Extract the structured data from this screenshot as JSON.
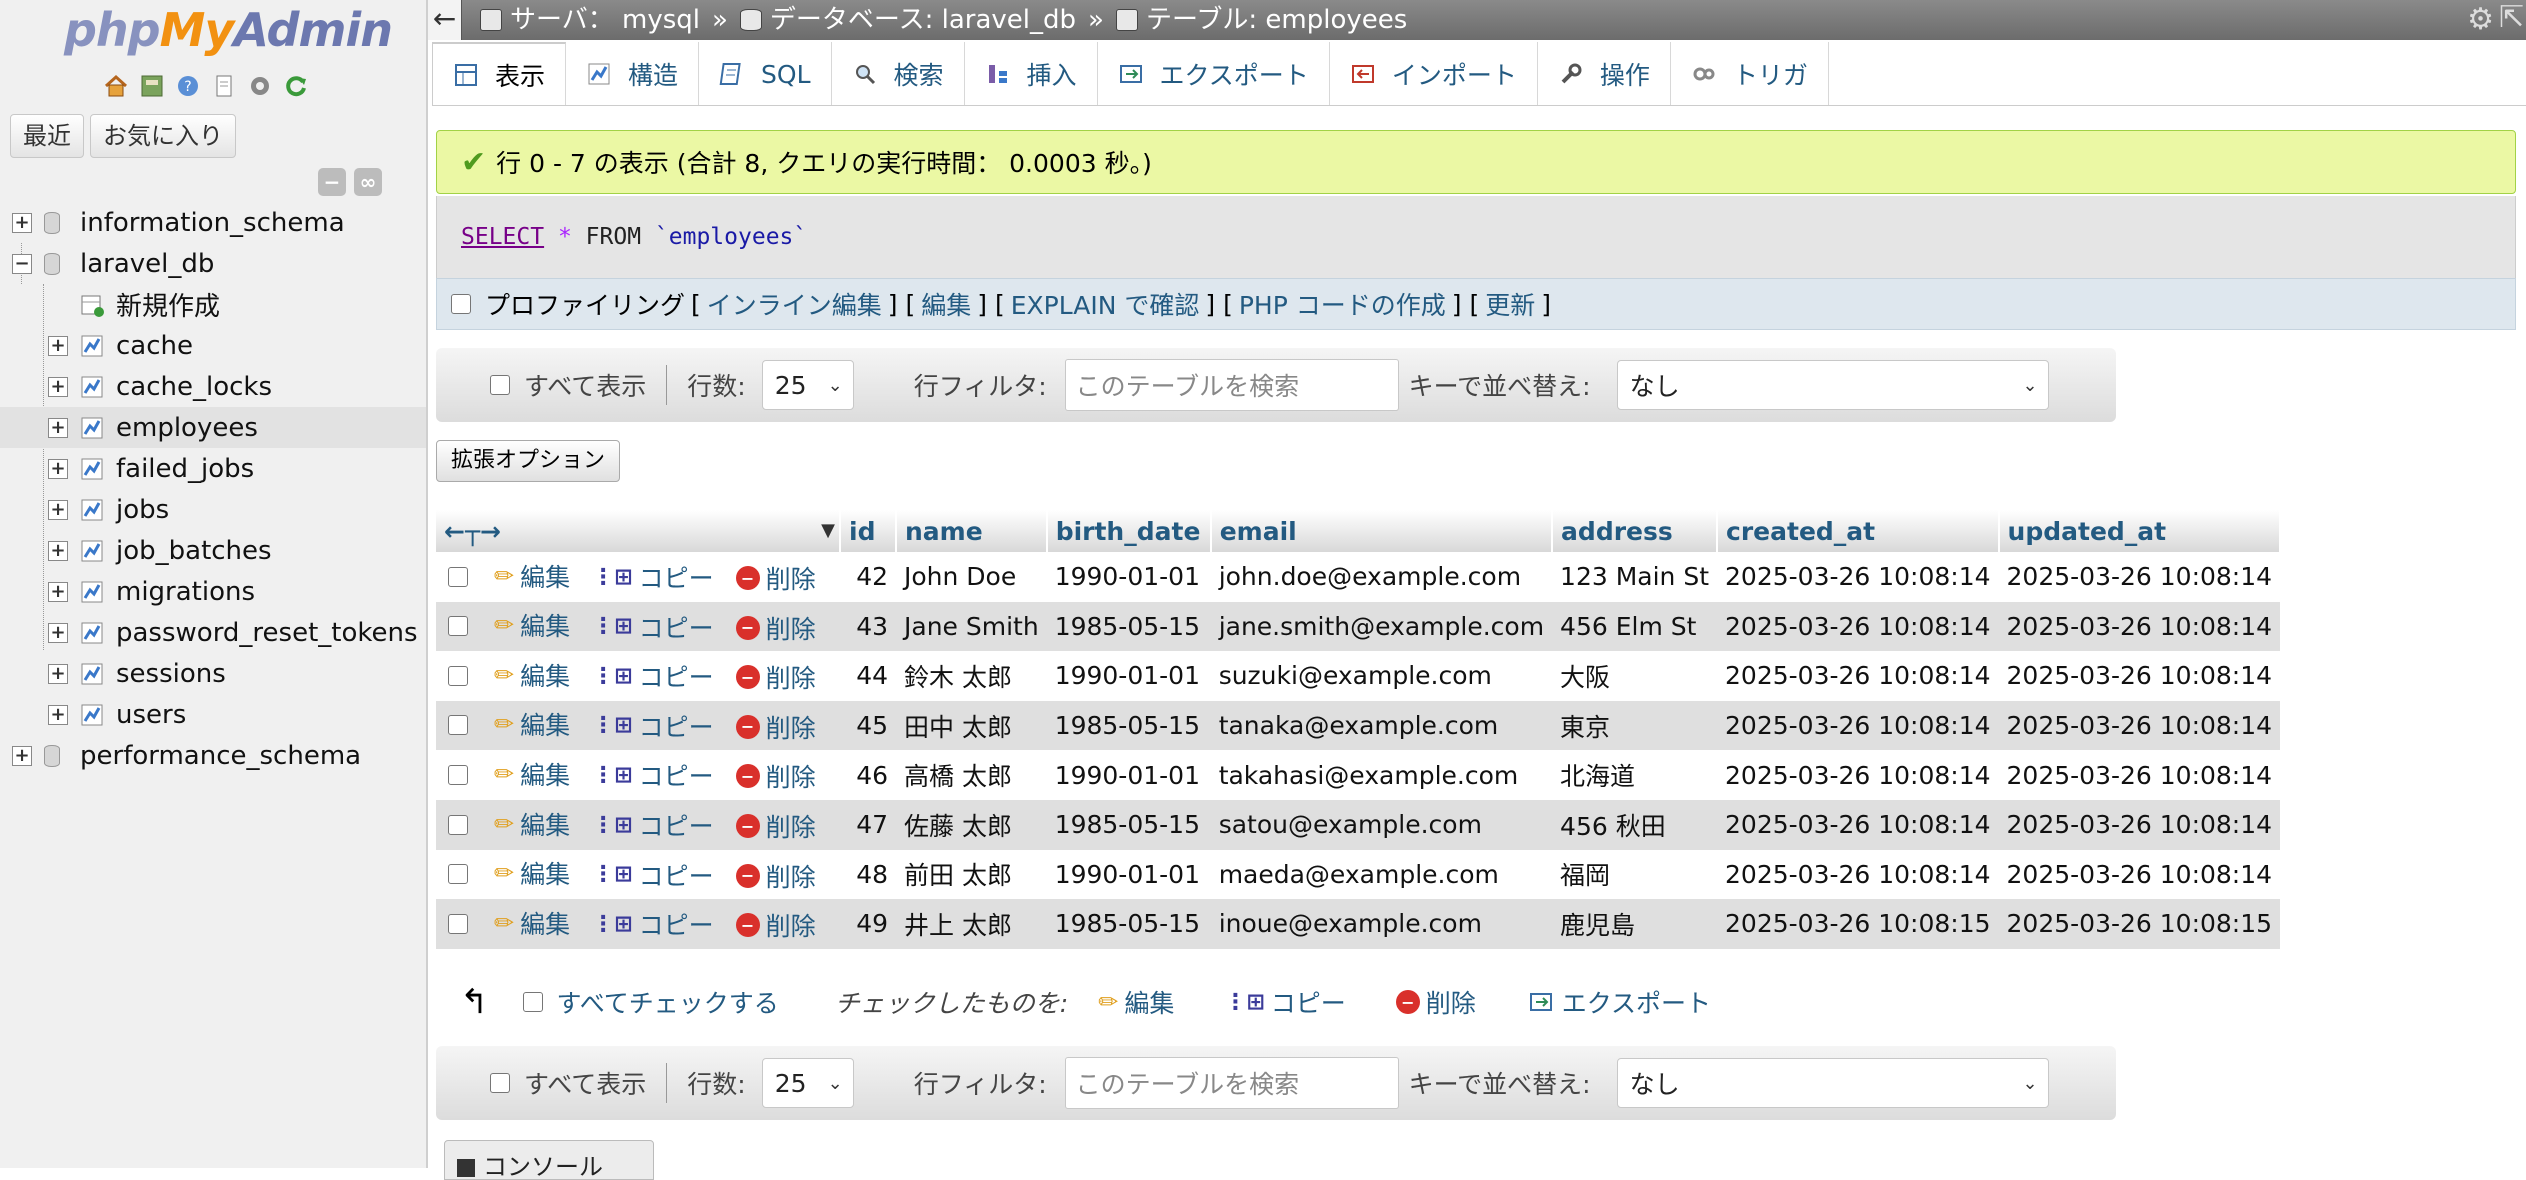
{
  "sidebar": {
    "logo": {
      "php": "php",
      "my": "My",
      "admin": "Admin"
    },
    "nav_icons": [
      "home-icon",
      "database-icon",
      "help-icon",
      "docs-icon",
      "settings-icon",
      "reload-icon"
    ],
    "tabs": {
      "recent": "最近",
      "favorites": "お気に入り"
    },
    "tree": [
      {
        "label": "information_schema",
        "type": "db",
        "expanded": false
      },
      {
        "label": "laravel_db",
        "type": "db",
        "expanded": true
      },
      {
        "label": "新規作成",
        "type": "new"
      },
      {
        "label": "cache",
        "type": "table"
      },
      {
        "label": "cache_locks",
        "type": "table"
      },
      {
        "label": "employees",
        "type": "table",
        "selected": true
      },
      {
        "label": "failed_jobs",
        "type": "table"
      },
      {
        "label": "jobs",
        "type": "table"
      },
      {
        "label": "job_batches",
        "type": "table"
      },
      {
        "label": "migrations",
        "type": "table"
      },
      {
        "label": "password_reset_tokens",
        "type": "table"
      },
      {
        "label": "sessions",
        "type": "table"
      },
      {
        "label": "users",
        "type": "table"
      },
      {
        "label": "performance_schema",
        "type": "db",
        "expanded": false
      }
    ]
  },
  "topbar": {
    "server": "サーバ： mysql",
    "database": "データベース: laravel_db",
    "table": "テーブル: employees",
    "separator": "»"
  },
  "tabs": [
    {
      "label": "表示",
      "icon": "browse-icon",
      "active": true
    },
    {
      "label": "構造",
      "icon": "structure-icon"
    },
    {
      "label": "SQL",
      "icon": "sql-icon"
    },
    {
      "label": "検索",
      "icon": "search-icon"
    },
    {
      "label": "挿入",
      "icon": "insert-icon"
    },
    {
      "label": "エクスポート",
      "icon": "export-icon"
    },
    {
      "label": "インポート",
      "icon": "import-icon"
    },
    {
      "label": "操作",
      "icon": "wrench-icon"
    },
    {
      "label": "トリガ",
      "icon": "trigger-icon"
    }
  ],
  "success_message": "行 0 - 7 の表示 (合計 8, クエリの実行時間： 0.0003 秒。)",
  "sql": {
    "select": "SELECT",
    "star": "*",
    "from": "FROM",
    "table": "`employees`"
  },
  "profiling": {
    "label": "プロファイリング",
    "links": [
      "インライン編集",
      "編集",
      "EXPLAIN で確認",
      "PHP コードの作成",
      "更新"
    ]
  },
  "nav_controls": {
    "show_all": "すべて表示",
    "rows_label": "行数:",
    "rows_value": "25",
    "filter_label": "行フィルタ:",
    "filter_placeholder": "このテーブルを検索",
    "sort_label": "キーで並べ替え:",
    "sort_value": "なし"
  },
  "options_button": "拡張オプション",
  "table": {
    "columns": [
      "id",
      "name",
      "birth_date",
      "email",
      "address",
      "created_at",
      "updated_at"
    ],
    "actions": {
      "edit": "編集",
      "copy": "コピー",
      "delete": "削除"
    },
    "rows": [
      {
        "id": "42",
        "name": "John Doe",
        "birth_date": "1990-01-01",
        "email": "john.doe@example.com",
        "address": "123 Main St",
        "created_at": "2025-03-26 10:08:14",
        "updated_at": "2025-03-26 10:08:14"
      },
      {
        "id": "43",
        "name": "Jane Smith",
        "birth_date": "1985-05-15",
        "email": "jane.smith@example.com",
        "address": "456 Elm St",
        "created_at": "2025-03-26 10:08:14",
        "updated_at": "2025-03-26 10:08:14"
      },
      {
        "id": "44",
        "name": "鈴木 太郎",
        "birth_date": "1990-01-01",
        "email": "suzuki@example.com",
        "address": "大阪",
        "created_at": "2025-03-26 10:08:14",
        "updated_at": "2025-03-26 10:08:14"
      },
      {
        "id": "45",
        "name": "田中 太郎",
        "birth_date": "1985-05-15",
        "email": "tanaka@example.com",
        "address": "東京",
        "created_at": "2025-03-26 10:08:14",
        "updated_at": "2025-03-26 10:08:14"
      },
      {
        "id": "46",
        "name": "高橋 太郎",
        "birth_date": "1990-01-01",
        "email": "takahasi@example.com",
        "address": "北海道",
        "created_at": "2025-03-26 10:08:14",
        "updated_at": "2025-03-26 10:08:14"
      },
      {
        "id": "47",
        "name": "佐藤 太郎",
        "birth_date": "1985-05-15",
        "email": "satou@example.com",
        "address": "456 秋田",
        "created_at": "2025-03-26 10:08:14",
        "updated_at": "2025-03-26 10:08:14"
      },
      {
        "id": "48",
        "name": "前田 太郎",
        "birth_date": "1990-01-01",
        "email": "maeda@example.com",
        "address": "福岡",
        "created_at": "2025-03-26 10:08:14",
        "updated_at": "2025-03-26 10:08:14"
      },
      {
        "id": "49",
        "name": "井上 太郎",
        "birth_date": "1985-05-15",
        "email": "inoue@example.com",
        "address": "鹿児島",
        "created_at": "2025-03-26 10:08:15",
        "updated_at": "2025-03-26 10:08:15"
      }
    ]
  },
  "bulk": {
    "check_all": "すべてチェックする",
    "with_selected": "チェックしたものを:",
    "edit": "編集",
    "copy": "コピー",
    "delete": "削除",
    "export": "エクスポート"
  },
  "console_label": "コンソール"
}
